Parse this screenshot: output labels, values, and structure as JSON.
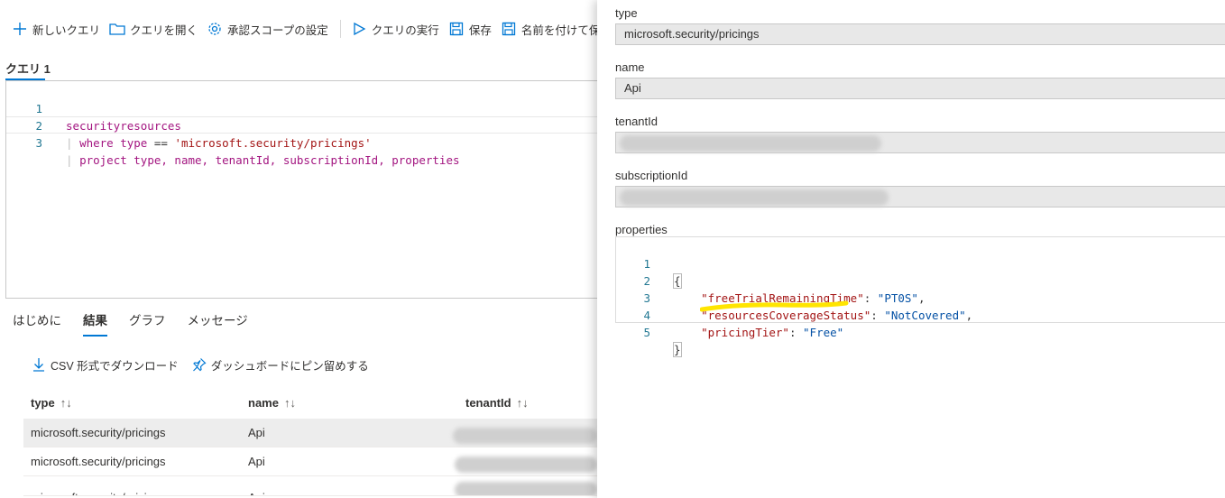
{
  "toolbar": {
    "new_query": "新しいクエリ",
    "open_query": "クエリを開く",
    "scope": "承認スコープの設定",
    "run": "クエリの実行",
    "save": "保存",
    "save_as": "名前を付けて保存"
  },
  "query_tab": "クエリ 1",
  "editor": {
    "line_numbers": [
      "1",
      "2",
      "3"
    ],
    "line1": "securityresources",
    "line2_pipe": "| ",
    "line2_kw": "where",
    "line2_field": "type",
    "line2_op": " == ",
    "line2_str": "'microsoft.security/pricings'",
    "line3_pipe": "| ",
    "line3_kw": "project",
    "line3_cols": "type, name, tenantId, subscriptionId, properties"
  },
  "result_tabs": [
    "はじめに",
    "結果",
    "グラフ",
    "メッセージ"
  ],
  "actions": {
    "csv": "CSV 形式でダウンロード",
    "pin": "ダッシュボードにピン留めする"
  },
  "grid": {
    "headers": [
      "type",
      "name",
      "tenantId"
    ],
    "sort_glyph": "↑↓",
    "rows": [
      {
        "type": "microsoft.security/pricings",
        "name": "Api"
      },
      {
        "type": "microsoft.security/pricings",
        "name": "Api"
      },
      {
        "type": "microsoft.security/pricings",
        "name": "Api"
      }
    ]
  },
  "detail": {
    "type_label": "type",
    "type_value": "microsoft.security/pricings",
    "name_label": "name",
    "name_value": "Api",
    "tenant_label": "tenantId",
    "subscription_label": "subscriptionId",
    "properties_label": "properties",
    "json_line_numbers": [
      "1",
      "2",
      "3",
      "4",
      "5"
    ],
    "json": {
      "open": "{",
      "k1": "\"freeTrialRemainingTime\"",
      "v1": "\"PT0S\"",
      "k2": "\"resourcesCoverageStatus\"",
      "v2": "\"NotCovered\"",
      "k3": "\"pricingTier\"",
      "v3": "\"Free\"",
      "close": "}",
      "colon": ": ",
      "comma": ","
    }
  },
  "colors": {
    "accent": "#0078d4",
    "highlight": "#ffe500"
  }
}
